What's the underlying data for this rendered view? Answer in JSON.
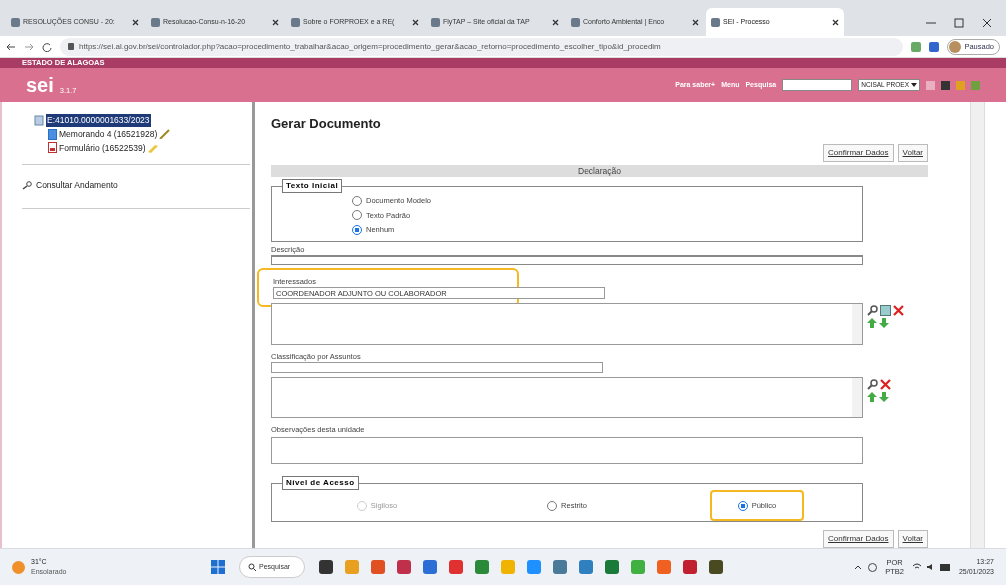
{
  "browser": {
    "tabs": [
      {
        "label": "RESOLUÇÕES CONSU - 20:",
        "selected": false
      },
      {
        "label": "Resolucao-Consu-n-16-20",
        "selected": false
      },
      {
        "label": "Sobre o FORPROEX e a RE(",
        "selected": false
      },
      {
        "label": "FlyTAP – Site oficial da TAP",
        "selected": false
      },
      {
        "label": "Conforto Ambiental | Enco",
        "selected": false
      },
      {
        "label": "SEI - Processo",
        "selected": true
      }
    ],
    "url": "https://sei.al.gov.br/sei/controlador.php?acao=procedimento_trabalhar&acao_origem=procedimento_gerar&acao_retorno=procedimento_escolher_tipo&id_procedim",
    "profile": "Pausado"
  },
  "header": {
    "state": "ESTADO DE ALAGOAS",
    "logo": "sei",
    "version": "3.1.7",
    "links": [
      "Para saber+",
      "Menu"
    ],
    "search_label": "Pesquisa",
    "unit": "NCISAL PROEX"
  },
  "tree": {
    "root": {
      "label": "E:41010.0000001633/2023",
      "selected": true
    },
    "children": [
      {
        "label": "Memorando 4 (16521928)",
        "kind": "doc"
      },
      {
        "label": "Formulário (16522539)",
        "kind": "pdf"
      }
    ],
    "consult": "Consultar Andamento"
  },
  "form": {
    "title": "Gerar Documento",
    "buttons": [
      "Confirmar Dados",
      "Voltar"
    ],
    "section": "Declaração",
    "texto_inicial": {
      "legend": "Texto Inicial",
      "options": [
        {
          "label": "Documento Modelo",
          "selected": false
        },
        {
          "label": "Texto Padrão",
          "selected": false
        },
        {
          "label": "Nenhum",
          "selected": true
        }
      ]
    },
    "descricao": {
      "label": "Descrição"
    },
    "interessados": {
      "label": "Interessados",
      "value": "COORDENADOR ADJUNTO OU COLABORADOR",
      "highlighted": true
    },
    "classificacao": {
      "label": "Classificação por Assuntos"
    },
    "observacoes": {
      "label": "Observações desta unidade"
    },
    "nivel_acesso": {
      "legend": "Nível de Acesso",
      "options": [
        {
          "label": "Sigiloso",
          "selected": false,
          "disabled": true,
          "highlighted": false
        },
        {
          "label": "Restrito",
          "selected": false,
          "disabled": false,
          "highlighted": false
        },
        {
          "label": "Público",
          "selected": true,
          "disabled": false,
          "highlighted": true
        }
      ]
    },
    "bottom_buttons": [
      "Confirmar Dados",
      "Voltar"
    ]
  },
  "taskbar": {
    "temperature": "31°C",
    "weather": "Ensolarado",
    "search": "Pesquisar",
    "lang": "POR",
    "layout": "PTB2",
    "time": "13:27",
    "date": "25/01/2023"
  }
}
